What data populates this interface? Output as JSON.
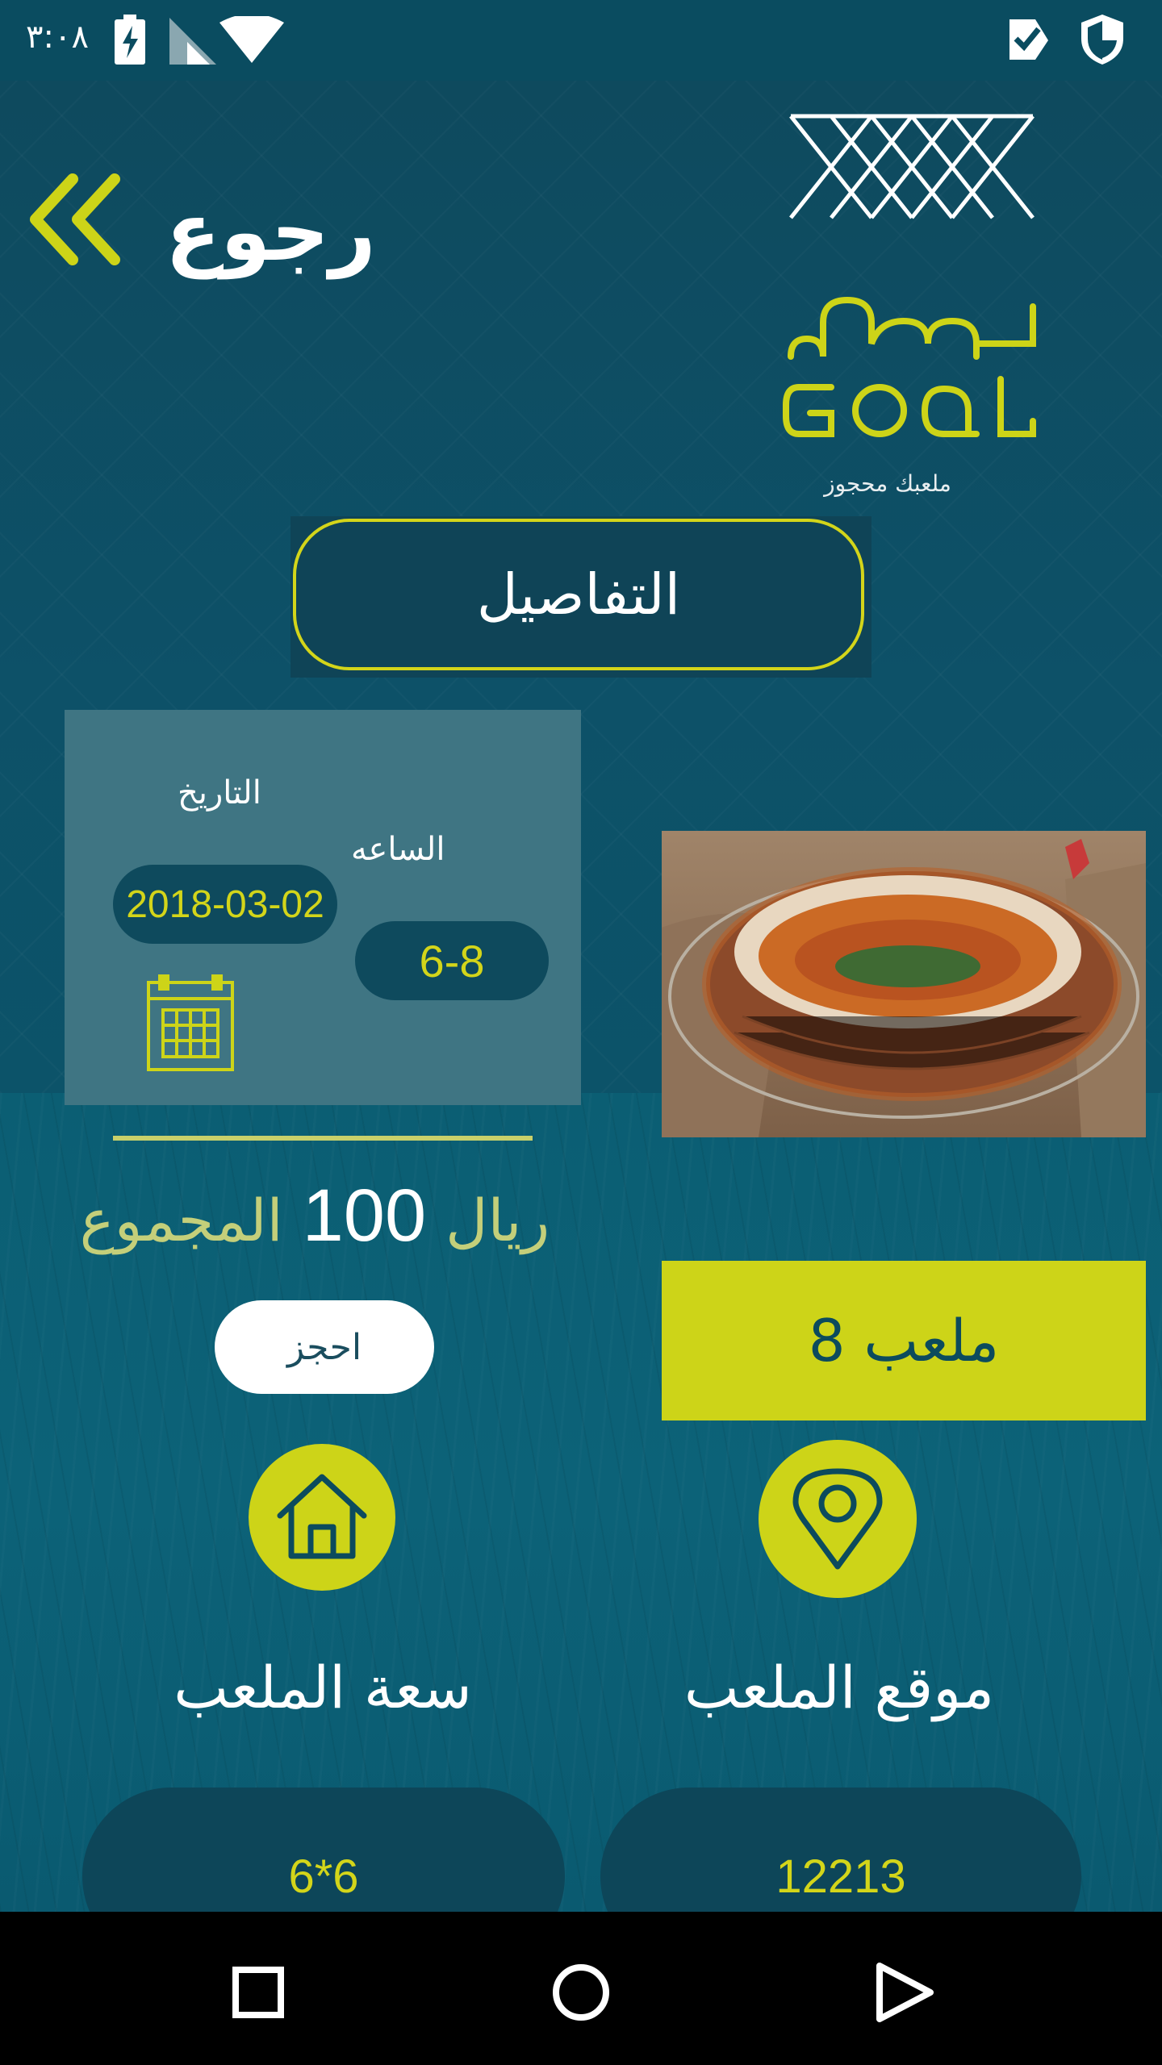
{
  "status_bar": {
    "time": "٣:٠٨",
    "icons": [
      "battery-charging-icon",
      "signal-icon",
      "wifi-icon",
      "check-badge-icon",
      "shield-icon"
    ]
  },
  "header": {
    "back_label": "رجوع",
    "back_icon": "double-chevron-left-icon",
    "logo_arabic": "مرمى",
    "logo_latin": "GOAL",
    "logo_tagline": "ملعبك محجوز"
  },
  "details_button": {
    "label": "التفاصيل"
  },
  "booking": {
    "date_label": "التاريخ",
    "time_label": "الساعه",
    "date_value": "2018-03-02",
    "time_value": "6-8",
    "calendar_icon": "calendar-icon"
  },
  "total": {
    "currency": "ريال",
    "amount": "100",
    "label": "المجموع"
  },
  "book_button": {
    "label": "احجز"
  },
  "stadium": {
    "image": "stadium-photo",
    "field_name": "ملعب 8"
  },
  "capacity": {
    "title": "سعة الملعب",
    "icon": "home-icon",
    "value": "6*6"
  },
  "location": {
    "title": "موقع الملعب",
    "icon": "location-pin-icon",
    "value": "12213"
  },
  "nav": {
    "buttons": [
      "recents-square-icon",
      "home-circle-icon",
      "back-triangle-icon"
    ]
  },
  "colors": {
    "accent": "#cdd418",
    "background": "#0c5266",
    "card": "#3f7583",
    "pill": "#0e4a5d"
  }
}
